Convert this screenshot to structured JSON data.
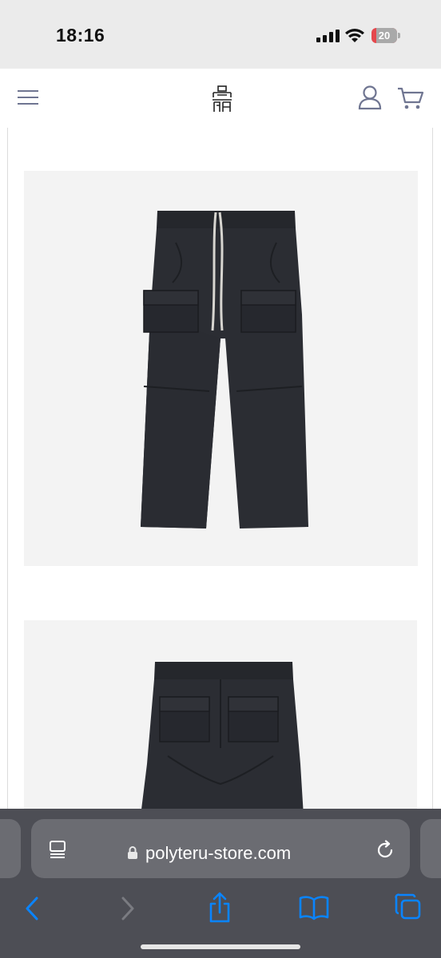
{
  "status_bar": {
    "time": "18:16",
    "battery_level": "20",
    "battery_color": "#e5484d"
  },
  "site_header": {
    "icons": [
      "menu-icon",
      "logo",
      "account-icon",
      "cart-icon"
    ]
  },
  "product_gallery": {
    "images": [
      {
        "name": "product-image-front",
        "description_icon": "cargo-pants-front"
      },
      {
        "name": "product-image-back",
        "description_icon": "cargo-pants-back"
      }
    ]
  },
  "browser": {
    "url": "polyteru-store.com",
    "accent_color": "#0a84ff",
    "toolbar_icons": [
      "back-icon",
      "forward-icon",
      "share-icon",
      "bookmarks-icon",
      "tabs-icon"
    ]
  }
}
